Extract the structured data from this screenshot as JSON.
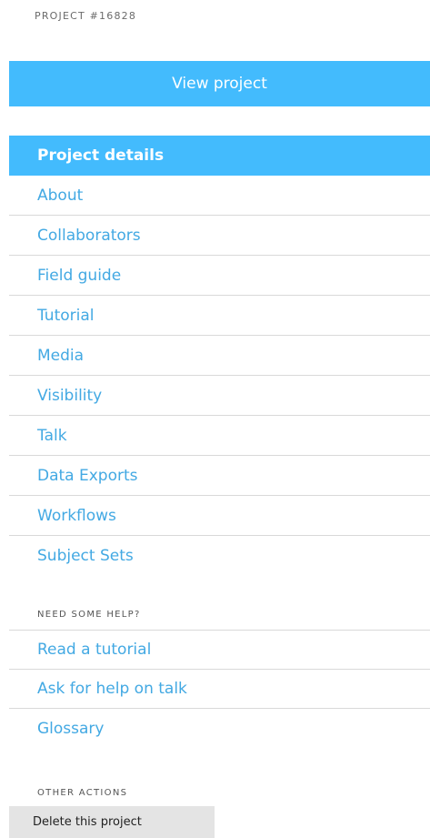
{
  "project": {
    "id_label": "PROJECT #16828",
    "view_button_label": "View project"
  },
  "nav": {
    "header": "Project details",
    "items": [
      "About",
      "Collaborators",
      "Field guide",
      "Tutorial",
      "Media",
      "Visibility",
      "Talk",
      "Data Exports",
      "Workflows",
      "Subject Sets"
    ]
  },
  "help": {
    "label": "NEED SOME HELP?",
    "items": [
      "Read a tutorial",
      "Ask for help on talk",
      "Glossary"
    ]
  },
  "other": {
    "label": "OTHER ACTIONS",
    "delete_label": "Delete this project"
  },
  "colors": {
    "accent": "#43bbfd",
    "link": "#43a9e3",
    "divider": "#d9d9d9",
    "button_gray": "#e4e4e4"
  }
}
